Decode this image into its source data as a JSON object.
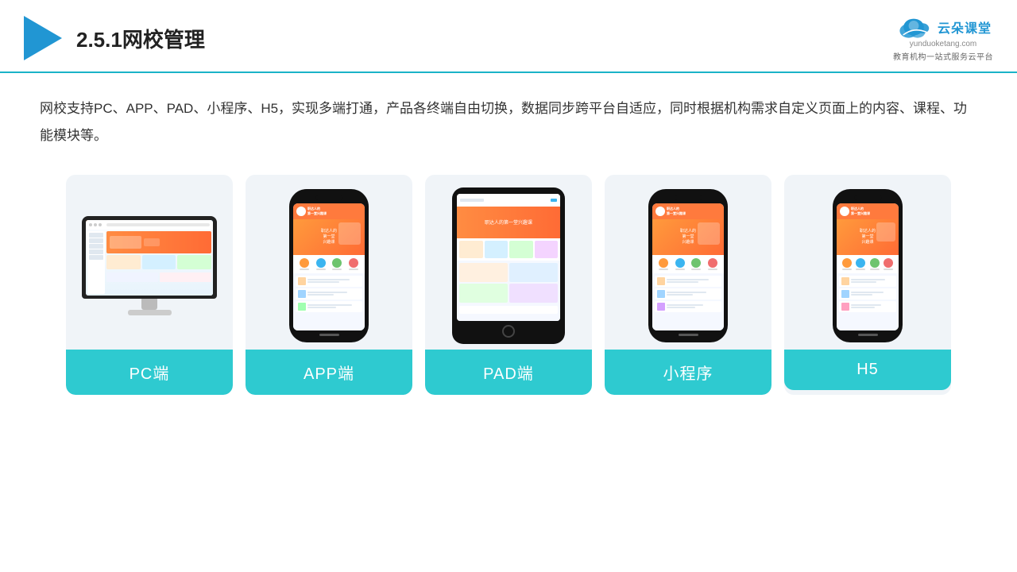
{
  "header": {
    "title": "2.5.1网校管理",
    "title_num": "2.5.1",
    "title_main": "网校管理",
    "logo_cn": "云朵课堂",
    "logo_url": "yunduoketang.com",
    "logo_sub": "教育机构一站式服务云平台"
  },
  "content": {
    "description": "网校支持PC、APP、PAD、小程序、H5，实现多端打通，产品各终端自由切换，数据同步跨平台自适应，同时根据机构需求自定义页面上的内容、课程、功能模块等。"
  },
  "cards": [
    {
      "id": "pc",
      "label": "PC端"
    },
    {
      "id": "app",
      "label": "APP端"
    },
    {
      "id": "pad",
      "label": "PAD端"
    },
    {
      "id": "mini",
      "label": "小程序"
    },
    {
      "id": "h5",
      "label": "H5"
    }
  ],
  "colors": {
    "card_bg": "#f0f4f8",
    "card_label_bg": "#2ecad0",
    "header_border": "#1ab3c8",
    "logo_blue": "#2196d3"
  }
}
